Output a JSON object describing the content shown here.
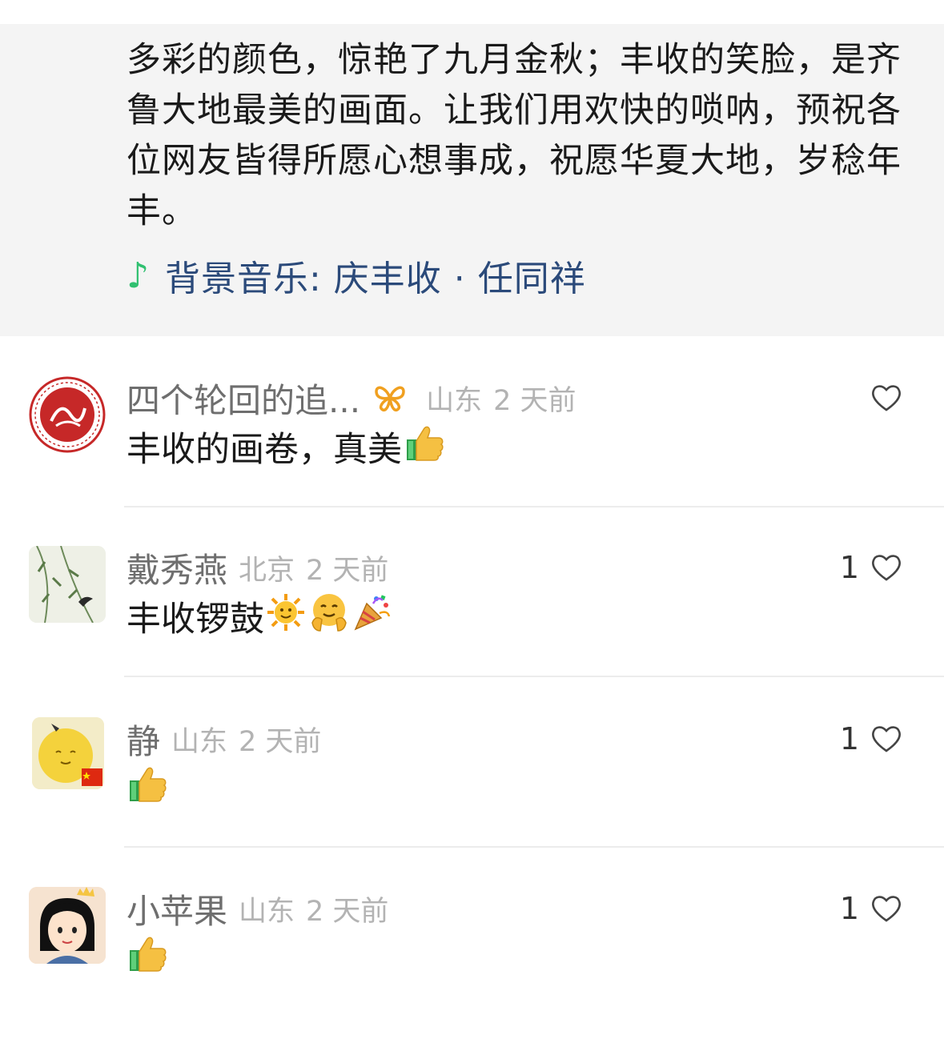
{
  "post": {
    "text": "多彩的颜色，惊艳了九月金秋；丰收的笑脸，是齐鲁大地最美的画面。让我们用欢快的唢呐，预祝各位网友皆得所愿心想事成，祝愿华夏大地，岁稔年丰。",
    "music_icon": "music-note-icon",
    "music_label": "背景音乐: 庆丰收 · 任同祥"
  },
  "comments": [
    {
      "name": "四个轮回的追...",
      "badge_icon": "butterfly-badge-icon",
      "location": "山东",
      "time": "2 天前",
      "text": "丰收的画卷，真美",
      "emojis": [
        "thumbs-up-icon"
      ],
      "likes": ""
    },
    {
      "name": "戴秀燕",
      "location": "北京",
      "time": "2 天前",
      "text": "丰收锣鼓",
      "emojis": [
        "sun-icon",
        "hugging-face-icon",
        "party-popper-icon"
      ],
      "likes": "1"
    },
    {
      "name": "静",
      "location": "山东",
      "time": "2 天前",
      "text": "",
      "emojis": [
        "thumbs-up-icon"
      ],
      "likes": "1"
    },
    {
      "name": "小苹果",
      "location": "山东",
      "time": "2 天前",
      "text": "",
      "emojis": [
        "thumbs-up-icon"
      ],
      "likes": "1"
    }
  ],
  "colors": {
    "panel_bg": "#f4f4f4",
    "link": "#2b4a7a",
    "music_note": "#30c070",
    "meta_gray": "#b3b3b3",
    "name_gray": "#6e6e6e"
  }
}
